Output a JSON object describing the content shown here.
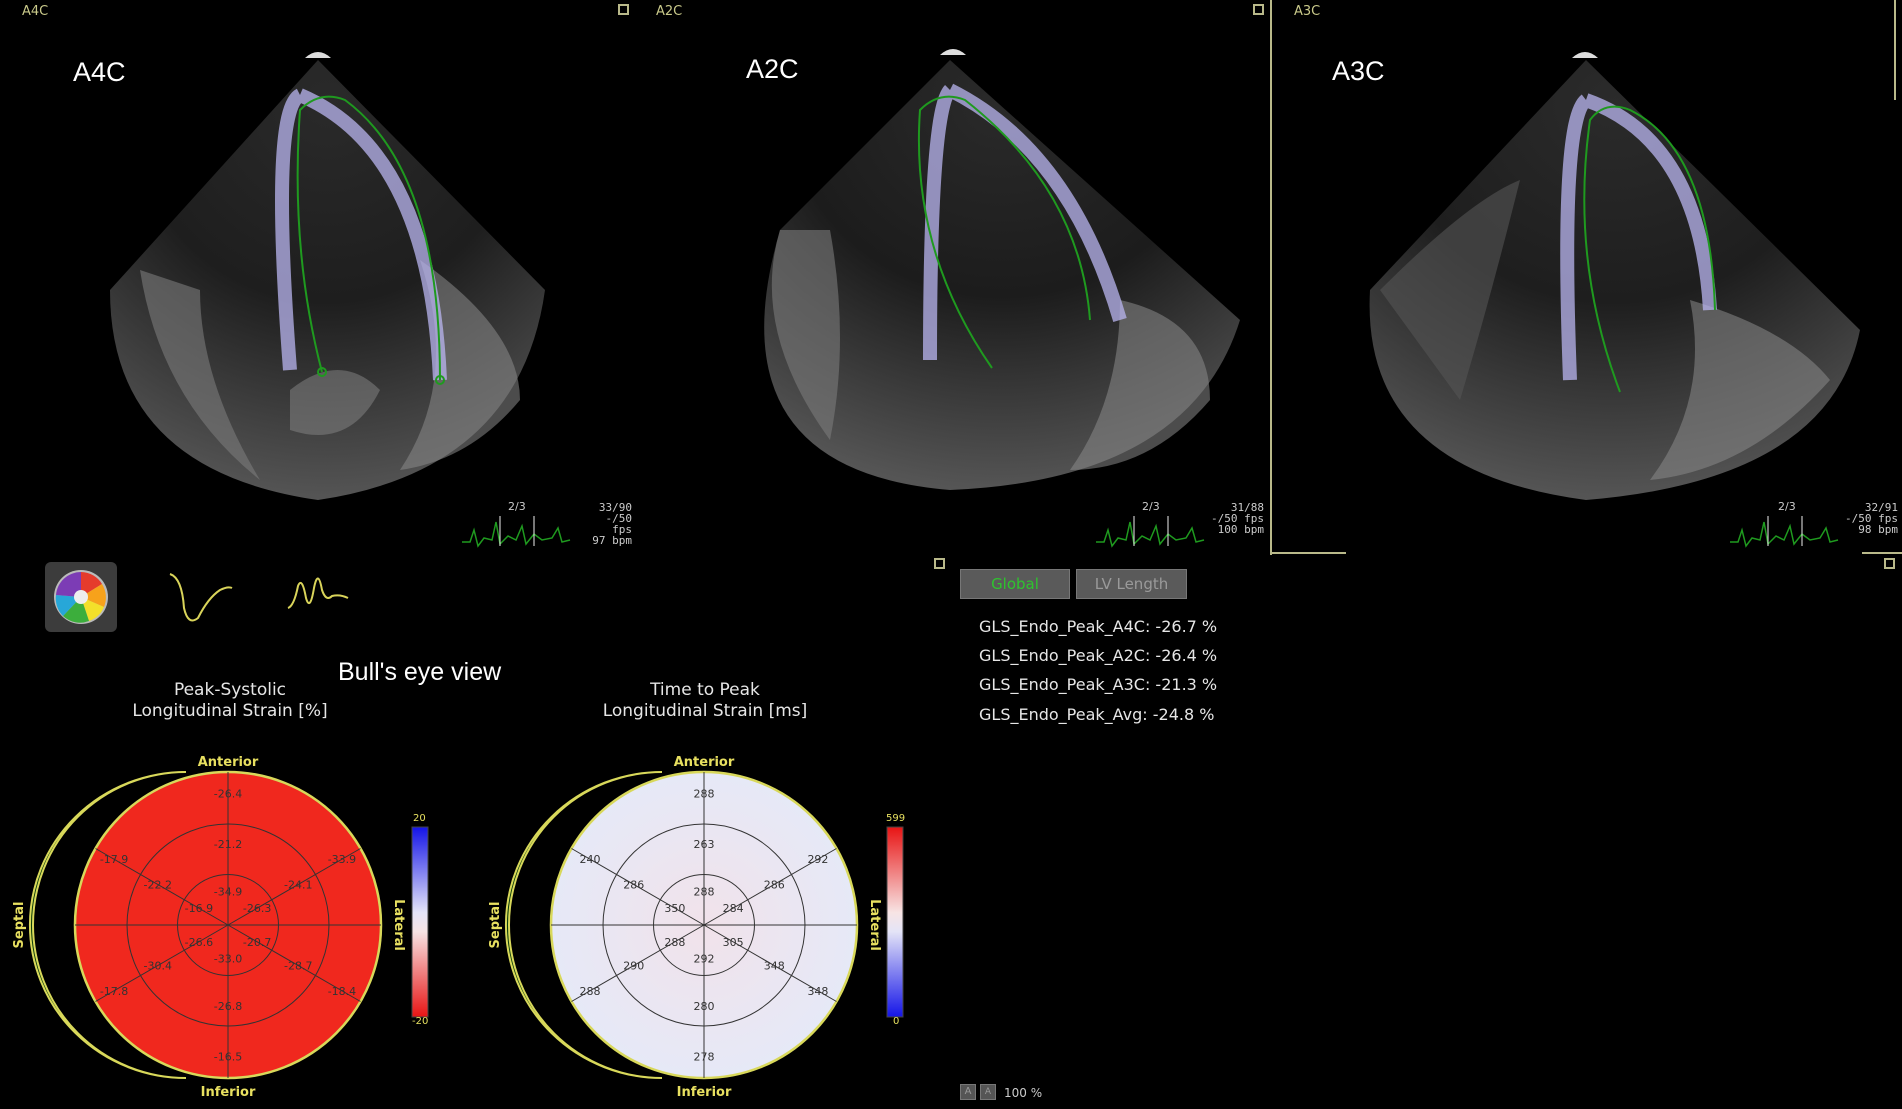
{
  "panes": [
    {
      "tag": "A4C",
      "label": "A4C",
      "frame": "2/3",
      "info": [
        "33/90",
        "-/50 fps",
        "97 bpm"
      ]
    },
    {
      "tag": "A2C",
      "label": "A2C",
      "frame": "2/3",
      "info": [
        "31/88",
        "-/50 fps",
        "100 bpm"
      ]
    },
    {
      "tag": "A3C",
      "label": "A3C",
      "frame": "2/3",
      "info": [
        "32/91",
        "-/50 fps",
        "98 bpm"
      ]
    }
  ],
  "tabs": {
    "global": "Global",
    "lv_length": "LV Length"
  },
  "gls": [
    "GLS_Endo_Peak_A4C: -26.7 %",
    "GLS_Endo_Peak_A2C: -26.4 %",
    "GLS_Endo_Peak_A3C: -21.3 %",
    "GLS_Endo_Peak_Avg: -24.8 %"
  ],
  "bulls_eye_caption": "Bull's eye view",
  "strain_map": {
    "title1": "Peak-Systolic",
    "title2": "Longitudinal Strain [%]",
    "scale_max": "20",
    "scale_min": "-20",
    "segments": [
      "-26.4",
      "-33.9",
      "-18.4",
      "-16.5",
      "-17.8",
      "-17.9",
      "-21.2",
      "-24.1",
      "-28.7",
      "-26.8",
      "-30.4",
      "-22.2",
      "-34.9",
      "-26.3",
      "-20.7",
      "-33.0",
      "-26.6",
      "-16.9"
    ]
  },
  "ttp_map": {
    "title1": "Time to Peak",
    "title2": "Longitudinal Strain [ms]",
    "scale_max": "599",
    "scale_min": "0",
    "segments": [
      "288",
      "292",
      "348",
      "278",
      "288",
      "240",
      "263",
      "286",
      "348",
      "280",
      "290",
      "286",
      "288",
      "284",
      "305",
      "292",
      "288",
      "350"
    ]
  },
  "orientation": {
    "anterior": "Anterior",
    "inferior": "Inferior",
    "septal": "Septal",
    "lateral": "Lateral"
  },
  "zoom": "100 %",
  "colors": {
    "strain_fill": "#f0281e",
    "septal_crescent": "#0b3d0b",
    "rim": "#d8d85a",
    "tab_active_text": "#2ec42e",
    "trace": "#1f9a1f",
    "trace_highlight": "#b9b6f0"
  },
  "icons": [
    "color-wheel-icon",
    "strain-curve-icon",
    "strain-rate-curve-icon",
    "ecg-trace-icon"
  ]
}
